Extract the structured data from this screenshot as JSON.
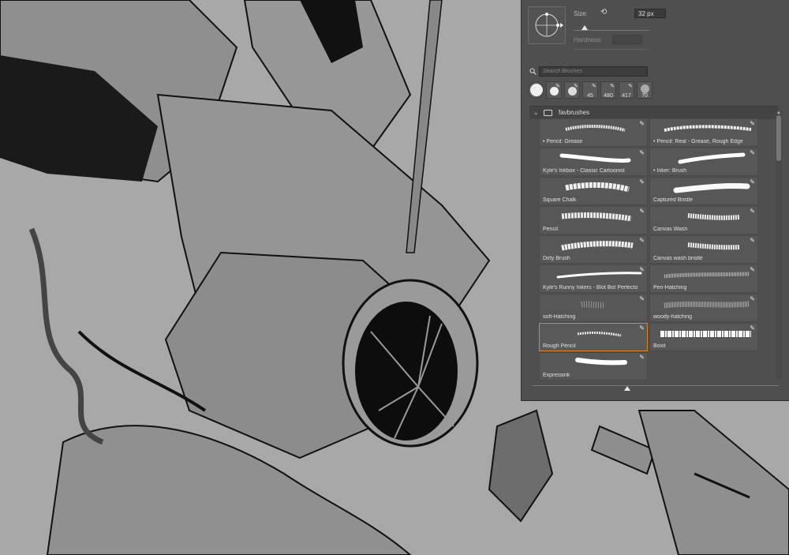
{
  "brush_panel": {
    "size_label": "Size:",
    "size_value": "32 px",
    "hardness_label": "Hardness:",
    "search_placeholder": "Search Brushes",
    "recent_brushes": [
      {
        "value": ""
      },
      {
        "value": ""
      },
      {
        "value": ""
      },
      {
        "value": "45"
      },
      {
        "value": "480"
      },
      {
        "value": "417"
      },
      {
        "value": "70"
      }
    ],
    "folder_name": "favbrushes",
    "brushes": [
      {
        "name": "• Pencil: Grease"
      },
      {
        "name": "• Pencil: Real - Grease, Rough Edge"
      },
      {
        "name": "Kyle's Inkbox - Classic Cartoonist"
      },
      {
        "name": "• Inker: Brush"
      },
      {
        "name": "Square Chalk"
      },
      {
        "name": "Captured Bristle"
      },
      {
        "name": "Pencil"
      },
      {
        "name": "Canvas Wash"
      },
      {
        "name": "Dirty Brush"
      },
      {
        "name": "Canvas wash bristle"
      },
      {
        "name": "Kyle's Runny Inkers - Blot Bot Perfecto"
      },
      {
        "name": "Pen-Hatching"
      },
      {
        "name": "soft-Hatching"
      },
      {
        "name": "woody-hatching"
      },
      {
        "name": "Rough Pencil"
      },
      {
        "name": "Boxit"
      },
      {
        "name": "Expressink"
      }
    ],
    "selected_brush": "Rough Pencil",
    "accent_color": "#e0812b"
  }
}
